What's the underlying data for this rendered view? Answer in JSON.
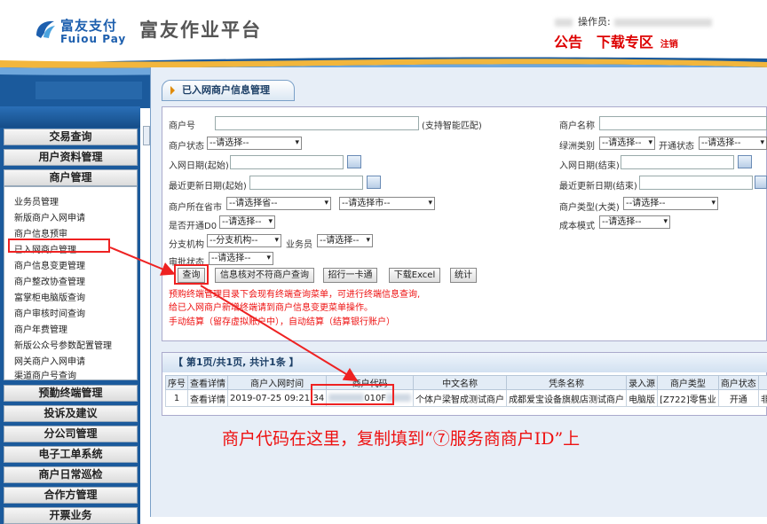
{
  "header": {
    "logo_cn": "富友支付",
    "logo_en": "Fuiou Pay",
    "platform_title": "富友作业平台",
    "operator_label": "操作员:",
    "links": {
      "notice": "公告",
      "download": "下载专区",
      "logout": "注销"
    }
  },
  "sidebar": {
    "menus": [
      "交易查询",
      "用户资料管理",
      "商户管理"
    ],
    "submenu": [
      "业务员管理",
      "新版商户入网申请",
      "商户信息预审",
      "已入网商户管理",
      "商户信息变更管理",
      "商户整改协查管理",
      "富掌柜电脑版查询",
      "商户审核时间查询",
      "商户年费管理",
      "新版公众号参数配置管理",
      "网关商户入网申请",
      "渠道商户号查询"
    ],
    "menus_bottom": [
      "预勤终端管理",
      "投诉及建议",
      "分公司管理",
      "电子工单系统",
      "商户日常巡检",
      "合作方管理",
      "开票业务"
    ]
  },
  "page": {
    "title": "已入网商户信息管理"
  },
  "form": {
    "merchant_no": "商户号",
    "smart_match": "(支持智能匹配)",
    "merchant_name": "商户名称",
    "merchant_status": "商户状态",
    "green_category": "绿洲类别",
    "open_status": "开通状态",
    "join_date_start": "入网日期(起始)",
    "join_date_end": "入网日期(结束)",
    "update_date_start": "最近更新日期(起始)",
    "update_date_end": "最近更新日期(结束)",
    "province_city": "商户所在省市",
    "merchant_type": "商户类型(大类)",
    "open_d0": "是否开通D0",
    "cost_mode": "成本模式",
    "branch": "分支机构",
    "salesman": "业务员",
    "review_status": "审批状态",
    "opt_select": "--请选择--",
    "opt_province": "--请选择省--",
    "opt_city": "--请选择市--",
    "opt_branch": "--分支机构--",
    "buttons": [
      "查询",
      "信息核对不符商户查询",
      "招行一卡通",
      "下载Excel",
      "统计"
    ],
    "notes": [
      "预购终端管理目录下会现有终端查询菜单，可进行终端信息查询,",
      "给已入网商户新增终端请到商户信息变更菜单操作。",
      "手动结算（留存虚拟账户中），自动结算（结算银行账户）"
    ]
  },
  "results": {
    "pager": "【 第1页/共1页, 共计1条 】",
    "columns": [
      "序号",
      "查看详情",
      "商户入网时间",
      "商户代码",
      "中文名称",
      "凭条名称",
      "录入源",
      "商户类型",
      "商户状态",
      "分支"
    ],
    "rows": [
      [
        "1",
        "查看详情",
        "2019-07-25 09:21:34",
        "010F",
        "个体户梁智成测试商户",
        "成都爱宝设备旗舰店测试商户",
        "电脑版",
        "[Z722]零售业",
        "开通",
        "非繁电子"
      ]
    ]
  },
  "caption": "商户代码在这里，复制填到“⑦服务商商户ID”上",
  "colors": {
    "brand_blue": "#1d5fae",
    "sidebar_blue": "#1b5a9c",
    "alert_red": "#e11111",
    "panel_bg": "#e7eef7"
  }
}
